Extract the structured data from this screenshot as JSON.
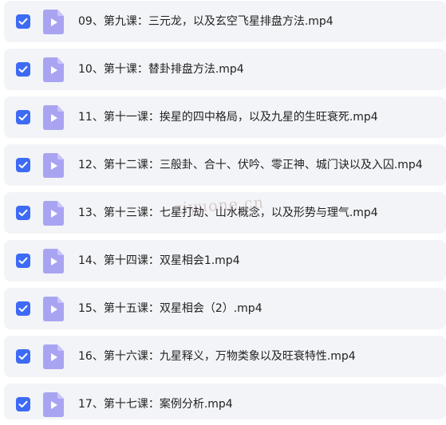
{
  "colors": {
    "row_bg": "#f3f4f7",
    "checkbox": "#3d6bf5",
    "file_icon": "#a9a4f2",
    "file_icon_fold": "#c9c5f8",
    "text": "#222222"
  },
  "icons": {
    "checkbox": "checkmark-icon",
    "file": "video-file-icon"
  },
  "files": [
    {
      "name": "09、第九课：三元龙，以及玄空飞星排盘方法.mp4",
      "checked": true
    },
    {
      "name": "10、第十课：替卦排盘方法.mp4",
      "checked": true
    },
    {
      "name": "11、第十一课：挨星的四中格局，以及九星的生旺衰死.mp4",
      "checked": true
    },
    {
      "name": "12、第十二课：三般卦、合十、伏吟、零正神、城门诀以及入囚.mp4",
      "checked": true
    },
    {
      "name": "13、第十三课：七星打劫、山水概念，以及形势与理气.mp4",
      "checked": true
    },
    {
      "name": "14、第十四课：双星相会1.mp4",
      "checked": true
    },
    {
      "name": "15、第十五课：双星相会（2）.mp4",
      "checked": true
    },
    {
      "name": "16、第十六课：九星释义，万物类象以及旺衰特性.mp4",
      "checked": true
    },
    {
      "name": "17、第十七课：案例分析.mp4",
      "checked": true
    }
  ],
  "watermark": "ziyuone.cn"
}
